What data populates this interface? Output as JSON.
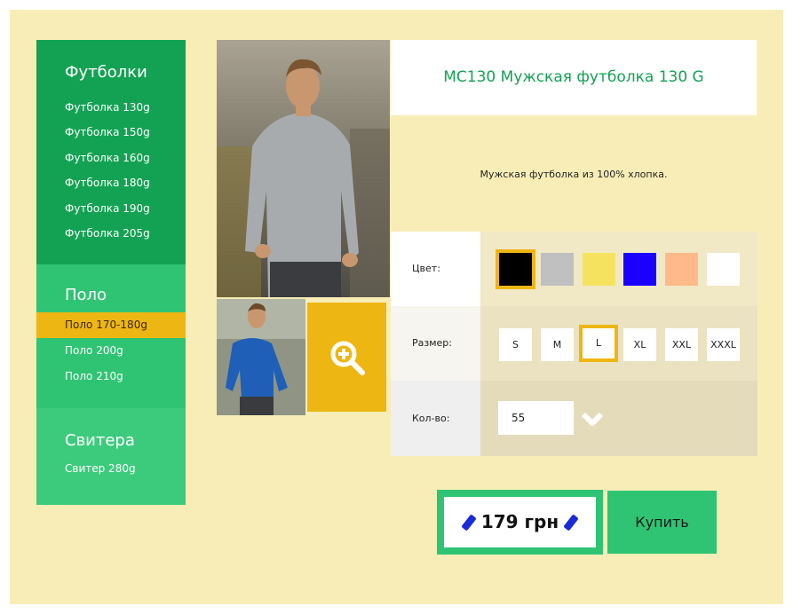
{
  "sidebar": {
    "sections": [
      {
        "title": "Футболки",
        "items": [
          "Футболка 130g",
          "Футболка 150g",
          "Футболка 160g",
          "Футболка 180g",
          "Футболка 190g",
          "Футболка 205g"
        ]
      },
      {
        "title": "Поло",
        "items": [
          "Поло 170-180g",
          "Поло 200g",
          "Поло 210g"
        ],
        "active_item": "Поло 170-180g"
      },
      {
        "title": "Свитера",
        "items": [
          "Свитер 280g"
        ]
      }
    ]
  },
  "product": {
    "title": "MC130 Мужская футболка 130 G",
    "description": "Мужская футболка из 100% хлопка."
  },
  "options": {
    "color_label": "Цвет:",
    "colors": [
      "#000000",
      "#c0c0c0",
      "#f5e35f",
      "#1b00ff",
      "#ffb98a",
      "#ffffff"
    ],
    "selected_color": "#000000",
    "size_label": "Размер:",
    "sizes": [
      "S",
      "M",
      "L",
      "XL",
      "XXL",
      "XXXL"
    ],
    "selected_size": "L",
    "qty_label": "Кол-во:",
    "qty_value": "55"
  },
  "price": {
    "text": "179 грн"
  },
  "buy_button": "Купить",
  "icons": {
    "zoom": "zoom-in-icon",
    "chevron": "chevron-down-icon"
  },
  "accent_colors": {
    "green_dark": "#13a253",
    "green": "#2fc473",
    "yellow": "#eeb613",
    "background": "#f8edb7"
  }
}
